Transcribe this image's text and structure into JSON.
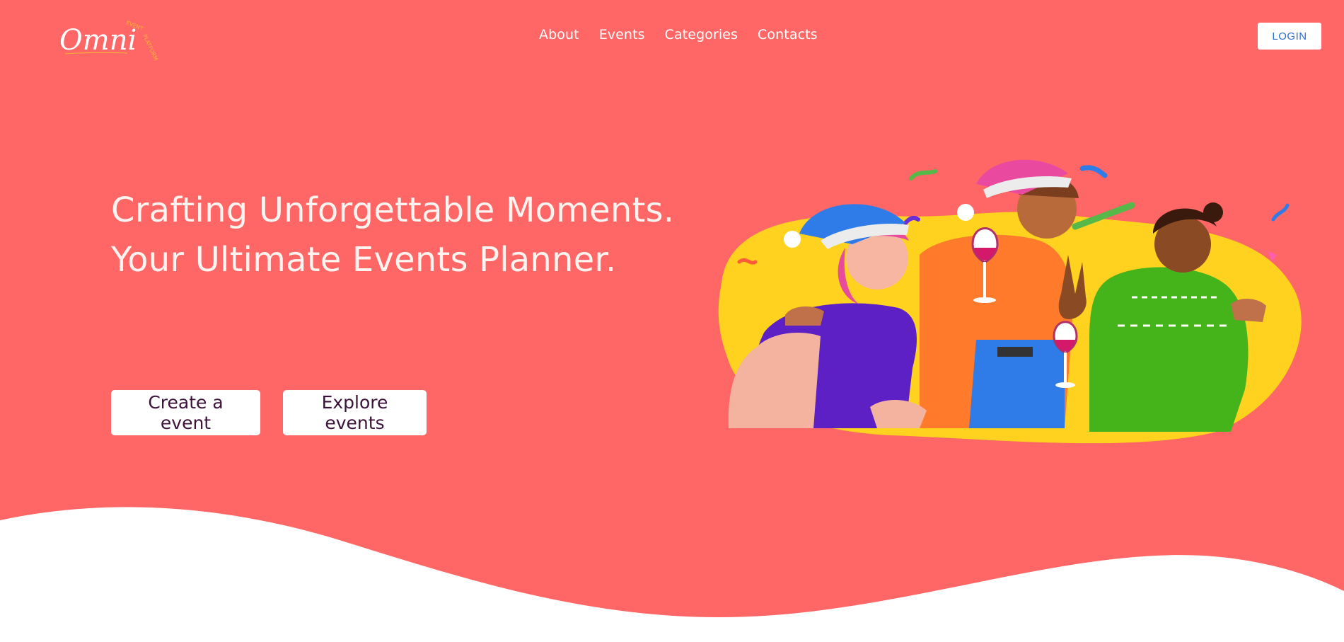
{
  "header": {
    "logo_text": "Omni",
    "logo_tagline": "EVENT PLATFORM",
    "nav": [
      {
        "label": "About"
      },
      {
        "label": "Events"
      },
      {
        "label": "Categories"
      },
      {
        "label": "Contacts"
      }
    ],
    "login_label": "LOGIN"
  },
  "hero": {
    "title": "Crafting Unforgettable Moments. Your Ultimate Events Planner.",
    "create_label": "Create a event",
    "explore_label": "Explore events",
    "illustration": "party-people-illustration"
  },
  "colors": {
    "hero_bg": "#ff6666",
    "wave": "#ffffff",
    "login_text": "#2b6fd4",
    "cta_text": "#3b1238"
  }
}
